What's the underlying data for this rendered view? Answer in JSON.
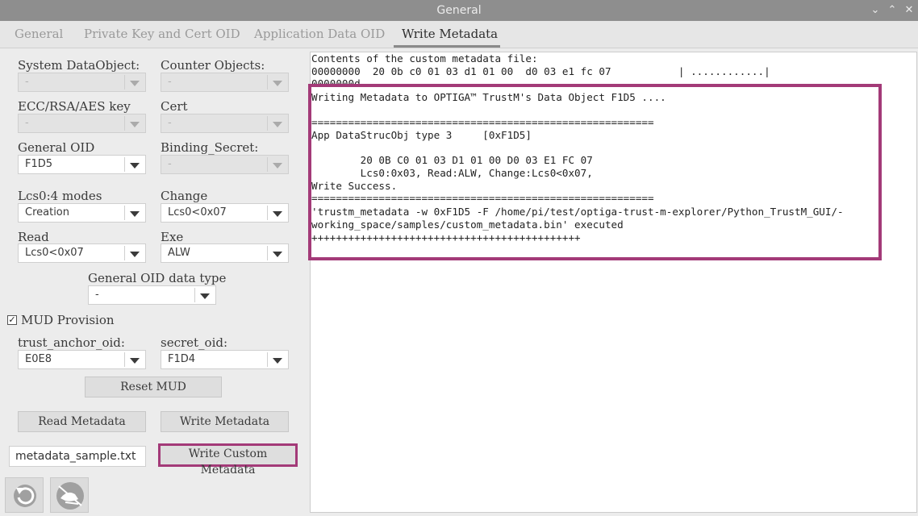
{
  "window": {
    "title": "General"
  },
  "tabs": [
    {
      "label": "General"
    },
    {
      "label": "Private Key and Cert OID"
    },
    {
      "label": "Application Data OID"
    },
    {
      "label": "Write Metadata"
    }
  ],
  "form": {
    "system_dataobject": {
      "label": "System DataObject:",
      "value": "-"
    },
    "counter_objects": {
      "label": "Counter Objects:",
      "value": "-"
    },
    "ecc_rsa_aes_key": {
      "label": "ECC/RSA/AES key",
      "value": "-"
    },
    "cert": {
      "label": "Cert",
      "value": "-"
    },
    "general_oid": {
      "label": "General OID",
      "value": "F1D5"
    },
    "binding_secret": {
      "label": "Binding_Secret:",
      "value": "-"
    },
    "lcs0_modes": {
      "label": "Lcs0:4 modes",
      "value": "Creation"
    },
    "change": {
      "label": "Change",
      "value": "Lcs0<0x07"
    },
    "read": {
      "label": "Read",
      "value": "Lcs0<0x07"
    },
    "exe": {
      "label": "Exe",
      "value": "ALW"
    },
    "general_oid_data_type": {
      "label": "General OID data type",
      "value": "-"
    },
    "mud_provision": {
      "label": "MUD Provision",
      "checked": true
    },
    "trust_anchor_oid": {
      "label": "trust_anchor_oid:",
      "value": "E0E8"
    },
    "secret_oid": {
      "label": "secret_oid:",
      "value": "F1D4"
    },
    "reset_mud_label": "Reset MUD",
    "read_metadata_label": "Read Metadata",
    "write_metadata_label": "Write Metadata",
    "filename": "metadata_sample.txt",
    "write_custom_metadata_label": "Write Custom Metadata"
  },
  "console": {
    "lines": [
      "Contents of the custom metadata file:",
      "00000000  20 0b c0 01 03 d1 01 00  d0 03 e1 fc 07           | ............|",
      "0000000d",
      "Writing Metadata to OPTIGA™ TrustM's Data Object F1D5 ....",
      "",
      "========================================================",
      "App DataStrucObj type 3     [0xF1D5]",
      "",
      "        20 0B C0 01 03 D1 01 00 D0 03 E1 FC 07",
      "        Lcs0:0x03, Read:ALW, Change:Lcs0<0x07,",
      "Write Success.",
      "========================================================",
      "'trustm_metadata -w 0xF1D5 -F /home/pi/test/optiga-trust-m-explorer/Python_TrustM_GUI/-",
      "working_space/samples/custom_metadata.bin' executed",
      "++++++++++++++++++++++++++++++++++++++++++++"
    ]
  },
  "colors": {
    "highlight": "#a33a78",
    "titlebar": "#8e8e8e"
  },
  "icons": {
    "back": "back-arrow-icon",
    "exit": "exit-plug-icon"
  }
}
